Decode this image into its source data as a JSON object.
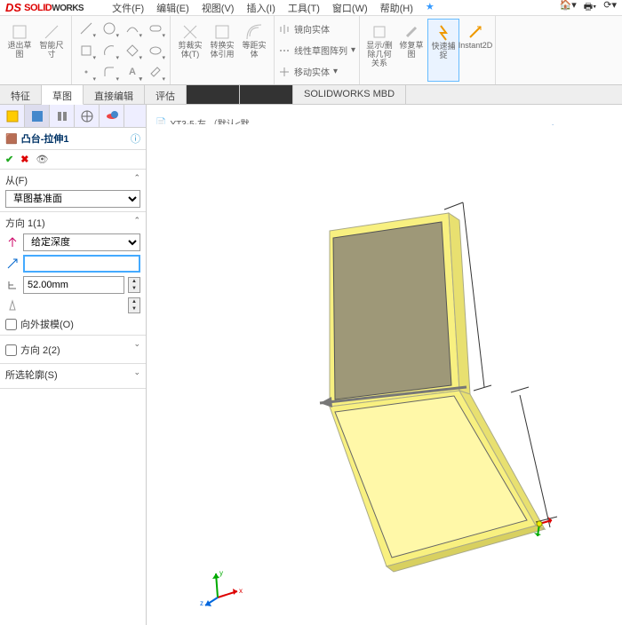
{
  "app": {
    "logo_ds": "DS",
    "logo_solid": "SOLID",
    "logo_works": "WORKS"
  },
  "menu": {
    "file": "文件(F)",
    "edit": "编辑(E)",
    "view": "视图(V)",
    "insert": "插入(I)",
    "tools": "工具(T)",
    "window": "窗口(W)",
    "help": "帮助(H)"
  },
  "ribbon": {
    "exit": "退出草图",
    "smart": "智能尺寸",
    "trim": "剪裁实体(T)",
    "convert": "转换实体引用",
    "offset": "等距实体",
    "mirror": "镜向实体",
    "linpat": "线性草图阵列",
    "move": "移动实体",
    "relations": "显示/删除几何关系",
    "repair": "修复草图",
    "quick": "快速捕捉",
    "instant": "Instant2D"
  },
  "tabs": {
    "feature": "特征",
    "sketch": "草图",
    "direct": "直接编辑",
    "evaluate": "评估",
    "a": "...",
    "b": "...",
    "mbd": "SOLIDWORKS MBD"
  },
  "docTab": "YT3-5-左 （默认<默...",
  "feature": {
    "title": "凸台-拉伸1",
    "from_label": "从(F)",
    "from_value": "草图基准面",
    "dir1_label": "方向 1(1)",
    "end_condition": "给定深度",
    "depth_field": "",
    "depth": "52.00mm",
    "draft_out": "向外拔模(O)",
    "dir2_label": "方向 2(2)",
    "thin_label": "所选轮廓(S)"
  },
  "chart_data": null
}
